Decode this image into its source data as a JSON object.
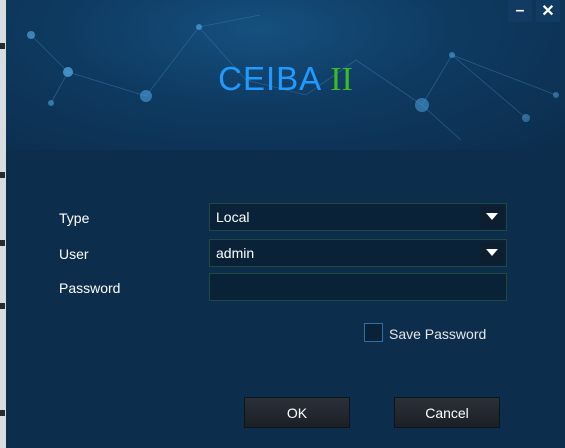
{
  "window": {
    "minimize_label": "–",
    "close_label": "✕"
  },
  "logo": {
    "brand": "CEIBA",
    "version": "II"
  },
  "form": {
    "type_label": "Type",
    "type_value": "Local",
    "user_label": "User",
    "user_value": "admin",
    "password_label": "Password",
    "password_value": "",
    "save_password_label": "Save Password",
    "save_password_checked": false
  },
  "buttons": {
    "ok_label": "OK",
    "cancel_label": "Cancel"
  },
  "colors": {
    "background": "#0c2d4c",
    "brand_blue": "#1f9bff",
    "brand_green": "#3dbb25"
  }
}
